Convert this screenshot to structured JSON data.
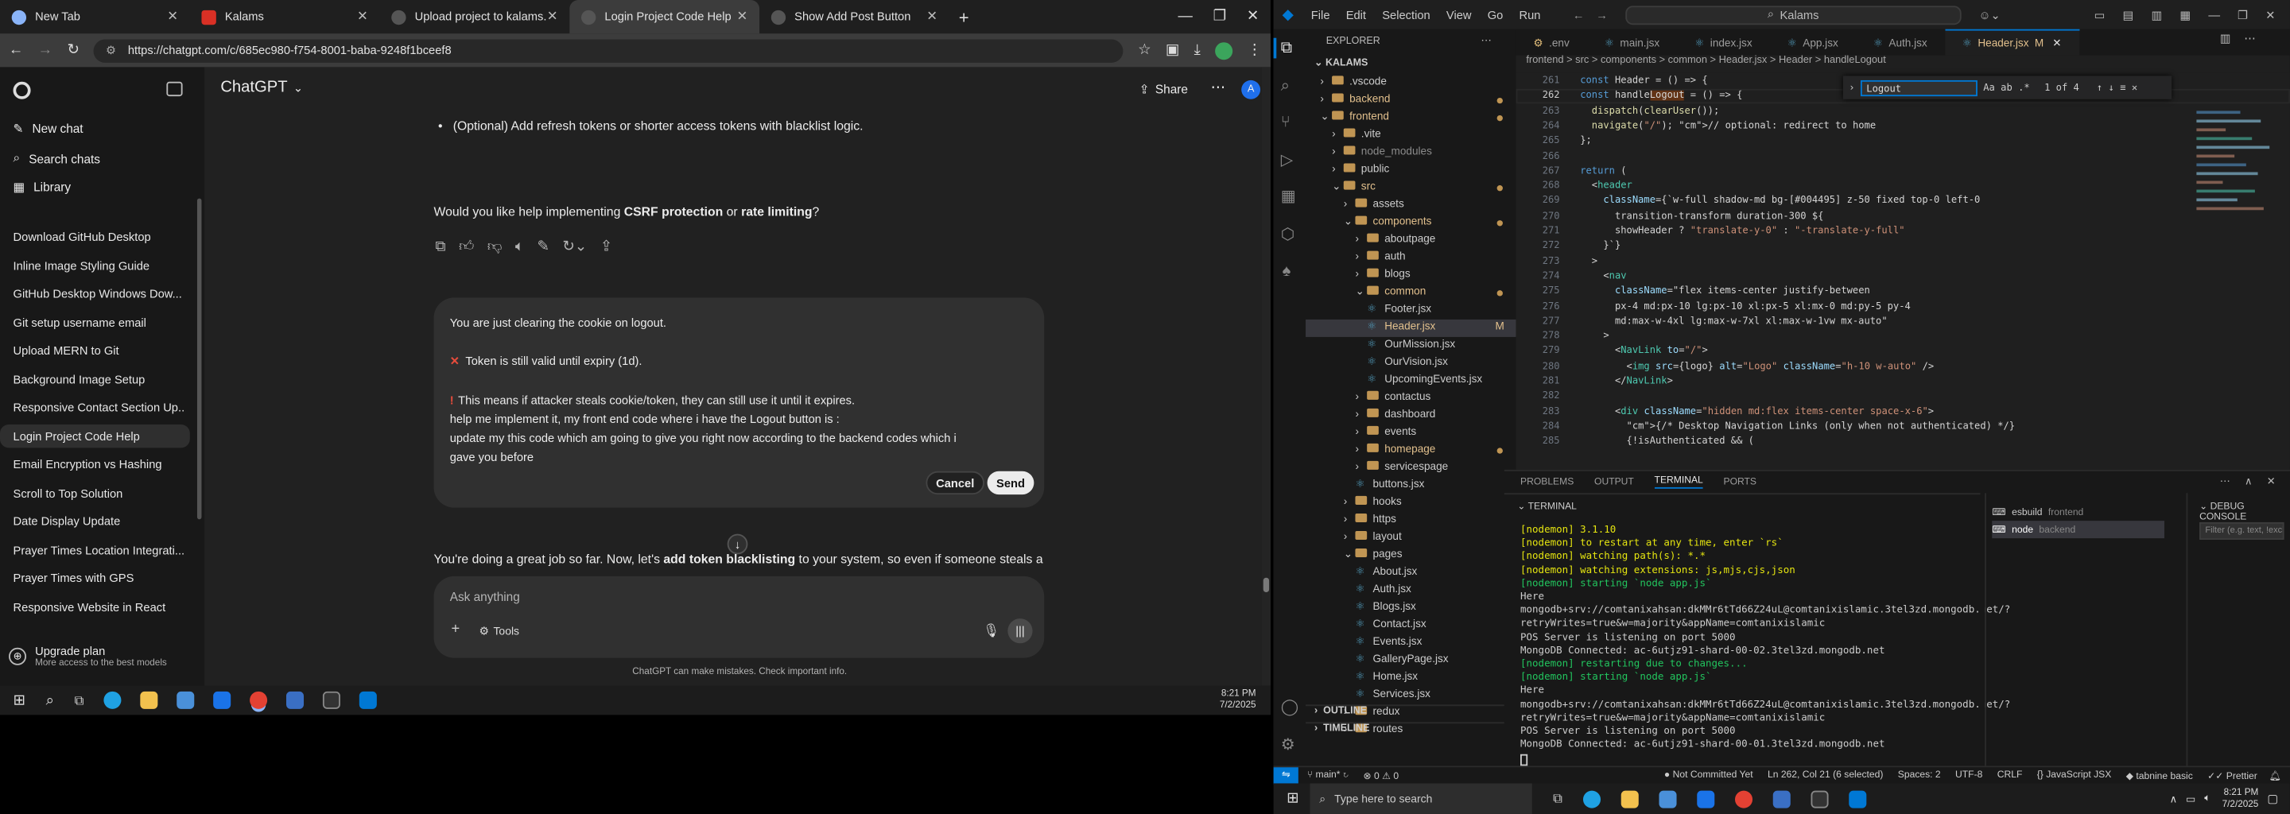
{
  "browser": {
    "tabs": [
      {
        "title": "New Tab",
        "color": "#8ab4f8"
      },
      {
        "title": "Kalams",
        "color": "#d93025"
      },
      {
        "title": "Upload project to kalams.org",
        "color": "#ececec"
      },
      {
        "title": "Login Project Code Help",
        "color": "#ececec"
      },
      {
        "title": "Show Add Post Button",
        "color": "#ececec"
      }
    ],
    "url": "https://chatgpt.com/c/685ec980-f754-8001-baba-9248f1bceef8"
  },
  "chatgpt": {
    "model": "ChatGPT",
    "share_label": "Share",
    "sidebar": {
      "new_chat": "New chat",
      "search_chats": "Search chats",
      "library": "Library",
      "chats": [
        "Download GitHub Desktop",
        "Inline Image Styling Guide",
        "GitHub Desktop Windows Dow...",
        "Git setup username email",
        "Upload MERN to Git",
        "Background Image Setup",
        "Responsive Contact Section Up...",
        "Login Project Code Help",
        "Email Encryption vs Hashing",
        "Scroll to Top Solution",
        "Date Display Update",
        "Prayer Times Location Integrati...",
        "Prayer Times with GPS",
        "Responsive Website in React"
      ],
      "upgrade_title": "Upgrade plan",
      "upgrade_sub": "More access to the best models"
    },
    "bullet": "(Optional) Add refresh tokens or shorter access tokens with blacklist logic.",
    "question_pre": "Would you like help implementing ",
    "question_b1": "CSRF protection",
    "question_mid": " or ",
    "question_b2": "rate limiting",
    "question_end": "?",
    "compose": {
      "line1": "You are just clearing the cookie on logout.",
      "line2": "Token is still valid until expiry (1d).",
      "line3": "This means if attacker steals cookie/token, they can still use it until it expires.",
      "line4": "help me implement it, my front end code where i have the Logout button is :",
      "line5": "update my this code which am going to give you right now according to the backend codes which i",
      "line6": "gave you before",
      "cancel": "Cancel",
      "send": "Send"
    },
    "reply_pre": "You're doing a great job so far. Now, let's ",
    "reply_bold": "add token blacklisting",
    "reply_post": " to your system, so even if someone steals a",
    "input_placeholder": "Ask anything",
    "tools_label": "Tools",
    "footer": "ChatGPT can make mistakes. Check important info."
  },
  "taskbar_left": {
    "time": "8:21 PM",
    "date": "7/2/2025"
  },
  "vscode": {
    "menu": [
      "File",
      "Edit",
      "Selection",
      "View",
      "Go",
      "Run"
    ],
    "search": "Kalams",
    "explorer_title": "EXPLORER",
    "root": "KALAMS",
    "tree": [
      {
        "label": ".vscode",
        "indent": 0,
        "type": "folder",
        "color": "#cccccc"
      },
      {
        "label": "backend",
        "indent": 0,
        "type": "folder",
        "color": "#e2c08d"
      },
      {
        "label": "frontend",
        "indent": 0,
        "type": "folder-open",
        "color": "#e2c08d"
      },
      {
        "label": ".vite",
        "indent": 1,
        "type": "folder",
        "color": "#cccccc"
      },
      {
        "label": "node_modules",
        "indent": 1,
        "type": "folder",
        "color": "#8b8b8b"
      },
      {
        "label": "public",
        "indent": 1,
        "type": "folder",
        "color": "#cccccc"
      },
      {
        "label": "src",
        "indent": 1,
        "type": "folder-open",
        "color": "#e2c08d"
      },
      {
        "label": "assets",
        "indent": 2,
        "type": "folder",
        "color": "#cccccc"
      },
      {
        "label": "components",
        "indent": 2,
        "type": "folder-open",
        "color": "#e2c08d"
      },
      {
        "label": "aboutpage",
        "indent": 3,
        "type": "folder",
        "color": "#cccccc"
      },
      {
        "label": "auth",
        "indent": 3,
        "type": "folder",
        "color": "#cccccc"
      },
      {
        "label": "blogs",
        "indent": 3,
        "type": "folder",
        "color": "#cccccc"
      },
      {
        "label": "common",
        "indent": 3,
        "type": "folder-open",
        "color": "#e2c08d"
      },
      {
        "label": "Footer.jsx",
        "indent": 4,
        "type": "file",
        "color": "#cccccc"
      },
      {
        "label": "Header.jsx",
        "indent": 4,
        "type": "file",
        "color": "#e2c08d",
        "badge": "M"
      },
      {
        "label": "OurMission.jsx",
        "indent": 4,
        "type": "file",
        "color": "#cccccc"
      },
      {
        "label": "OurVision.jsx",
        "indent": 4,
        "type": "file",
        "color": "#cccccc"
      },
      {
        "label": "UpcomingEvents.jsx",
        "indent": 4,
        "type": "file",
        "color": "#cccccc"
      },
      {
        "label": "contactus",
        "indent": 3,
        "type": "folder",
        "color": "#cccccc"
      },
      {
        "label": "dashboard",
        "indent": 3,
        "type": "folder",
        "color": "#cccccc"
      },
      {
        "label": "events",
        "indent": 3,
        "type": "folder",
        "color": "#cccccc"
      },
      {
        "label": "homepage",
        "indent": 3,
        "type": "folder",
        "color": "#e2c08d"
      },
      {
        "label": "servicespage",
        "indent": 3,
        "type": "folder",
        "color": "#cccccc"
      },
      {
        "label": "buttons.jsx",
        "indent": 3,
        "type": "file",
        "color": "#cccccc"
      },
      {
        "label": "hooks",
        "indent": 2,
        "type": "folder",
        "color": "#cccccc"
      },
      {
        "label": "https",
        "indent": 2,
        "type": "folder",
        "color": "#cccccc"
      },
      {
        "label": "layout",
        "indent": 2,
        "type": "folder",
        "color": "#cccccc"
      },
      {
        "label": "pages",
        "indent": 2,
        "type": "folder-open",
        "color": "#cccccc"
      },
      {
        "label": "About.jsx",
        "indent": 3,
        "type": "file",
        "color": "#cccccc"
      },
      {
        "label": "Auth.jsx",
        "indent": 3,
        "type": "file",
        "color": "#cccccc"
      },
      {
        "label": "Blogs.jsx",
        "indent": 3,
        "type": "file",
        "color": "#cccccc"
      },
      {
        "label": "Contact.jsx",
        "indent": 3,
        "type": "file",
        "color": "#cccccc"
      },
      {
        "label": "Events.jsx",
        "indent": 3,
        "type": "file",
        "color": "#cccccc"
      },
      {
        "label": "GalleryPage.jsx",
        "indent": 3,
        "type": "file",
        "color": "#cccccc"
      },
      {
        "label": "Home.jsx",
        "indent": 3,
        "type": "file",
        "color": "#cccccc"
      },
      {
        "label": "Services.jsx",
        "indent": 3,
        "type": "file",
        "color": "#cccccc"
      },
      {
        "label": "redux",
        "indent": 2,
        "type": "folder",
        "color": "#cccccc"
      },
      {
        "label": "routes",
        "indent": 2,
        "type": "folder",
        "color": "#cccccc"
      }
    ],
    "outline": "OUTLINE",
    "timeline": "TIMELINE",
    "tabs": [
      ".env",
      "main.jsx",
      "index.jsx",
      "App.jsx",
      "Auth.jsx",
      "Header.jsx"
    ],
    "active_tab_badge": "M",
    "breadcrumbs": "frontend > src > components > common > Header.jsx > Header > handleLogout",
    "find_value": "Logout",
    "find_count": "1 of 4",
    "code": [
      {
        "n": "261",
        "t": "  const Header = () => {"
      },
      {
        "n": "262",
        "t": "  const handleLogout = () => {"
      },
      {
        "n": "263",
        "t": "    dispatch(clearUser());"
      },
      {
        "n": "264",
        "t": "    navigate(\"/\"); // optional: redirect to home"
      },
      {
        "n": "265",
        "t": "  };"
      },
      {
        "n": "266",
        "t": ""
      },
      {
        "n": "267",
        "t": "  return ("
      },
      {
        "n": "268",
        "t": "    <header"
      },
      {
        "n": "269",
        "t": "      className={`w-full shadow-md bg-[#004495] z-50 fixed top-0 left-0"
      },
      {
        "n": "270",
        "t": "        transition-transform duration-300 ${"
      },
      {
        "n": "271",
        "t": "        showHeader ? \"translate-y-0\" : \"-translate-y-full\""
      },
      {
        "n": "272",
        "t": "      }`}"
      },
      {
        "n": "273",
        "t": "    >"
      },
      {
        "n": "274",
        "t": "      <nav"
      },
      {
        "n": "275",
        "t": "        className=\"flex items-center justify-between"
      },
      {
        "n": "276",
        "t": "        px-4 md:px-10 lg:px-10 xl:px-5 xl:mx-0 md:py-5 py-4"
      },
      {
        "n": "277",
        "t": "        md:max-w-4xl lg:max-w-7xl xl:max-w-1vw mx-auto\""
      },
      {
        "n": "278",
        "t": "      >"
      },
      {
        "n": "279",
        "t": "        <NavLink to=\"/\">"
      },
      {
        "n": "280",
        "t": "          <img src={logo} alt=\"Logo\" className=\"h-10 w-auto\" />"
      },
      {
        "n": "281",
        "t": "        </NavLink>"
      },
      {
        "n": "282",
        "t": ""
      },
      {
        "n": "283",
        "t": "        <div className=\"hidden md:flex items-center space-x-6\">"
      },
      {
        "n": "284",
        "t": "          {/* Desktop Navigation Links (only when not authenticated) */}"
      },
      {
        "n": "285",
        "t": "          {!isAuthenticated && ("
      }
    ],
    "panel_tabs": [
      "PROBLEMS",
      "OUTPUT",
      "TERMINAL",
      "PORTS"
    ],
    "active_panel": "TERMINAL",
    "debug_console": "DEBUG CONSOLE",
    "terminal_title": "TERMINAL",
    "terminal": [
      {
        "t": "[nodemon] 3.1.10",
        "c": "yellow"
      },
      {
        "t": "[nodemon] to restart at any time, enter `rs`",
        "c": "yellow"
      },
      {
        "t": "[nodemon] watching path(s): *.*",
        "c": "yellow"
      },
      {
        "t": "[nodemon] watching extensions: js,mjs,cjs,json",
        "c": "yellow"
      },
      {
        "t": "[nodemon] starting `node app.js`",
        "c": "green"
      },
      {
        "t": "Here",
        "c": ""
      },
      {
        "t": "mongodb+srv://comtanixahsan:dkMMr6tTd66Z24uL@comtanixislamic.3tel3zd.mongodb.net/?",
        "c": ""
      },
      {
        "t": "retryWrites=true&w=majority&appName=comtanixislamic",
        "c": ""
      },
      {
        "t": "POS Server is listening on port 5000",
        "c": ""
      },
      {
        "t": "MongoDB Connected: ac-6utjz91-shard-00-02.3tel3zd.mongodb.net",
        "c": ""
      },
      {
        "t": "[nodemon] restarting due to changes...",
        "c": "green"
      },
      {
        "t": "[nodemon] starting `node app.js`",
        "c": "green"
      },
      {
        "t": "Here",
        "c": ""
      },
      {
        "t": "mongodb+srv://comtanixahsan:dkMMr6tTd66Z24uL@comtanixislamic.3tel3zd.mongodb.net/?",
        "c": ""
      },
      {
        "t": "retryWrites=true&w=majority&appName=comtanixislamic",
        "c": ""
      },
      {
        "t": "POS Server is listening on port 5000",
        "c": ""
      },
      {
        "t": "MongoDB Connected: ac-6utjz91-shard-00-01.3tel3zd.mongodb.net",
        "c": ""
      }
    ],
    "terminals": [
      {
        "name": "esbuild",
        "folder": "frontend"
      },
      {
        "name": "node",
        "folder": "backend"
      }
    ],
    "debug_filter_placeholder": "Filter (e.g. text, !exclude, \\escape)",
    "status": {
      "branch": "main*",
      "errors": "0",
      "warnings": "0",
      "not_committed": "Not Committed Yet",
      "position": "Ln 262, Col 21 (6 selected)",
      "spaces": "Spaces: 2",
      "encoding": "UTF-8",
      "eol": "CRLF",
      "language": "JavaScript JSX",
      "tabnine": "tabnine basic",
      "prettier": "Prettier"
    }
  },
  "taskbar_right": {
    "search_placeholder": "Type here to search",
    "time": "8:21 PM",
    "date": "7/2/2025"
  }
}
